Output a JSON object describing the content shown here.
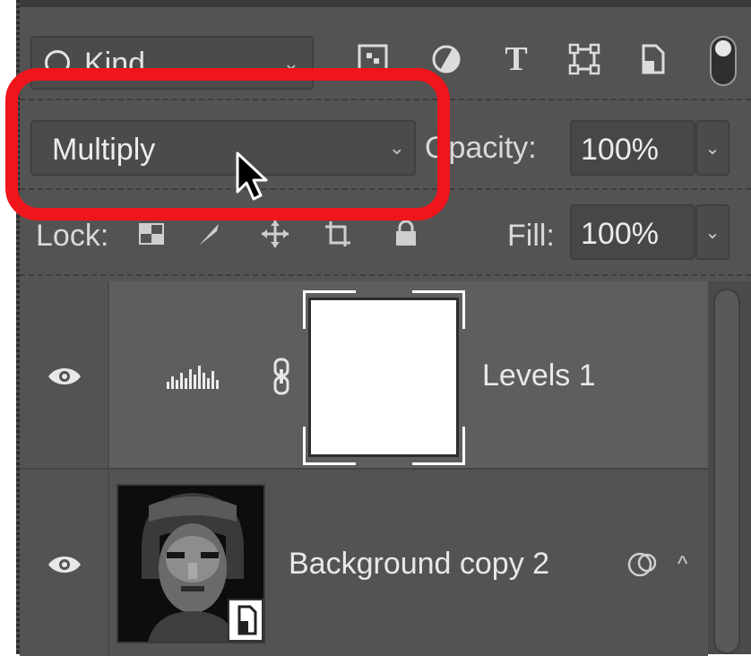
{
  "filter": {
    "kind_label": "Kind",
    "icons": [
      "pixel-filter-icon",
      "adjustment-filter-icon",
      "type-filter-icon",
      "shape-filter-icon",
      "smart-object-filter-icon"
    ]
  },
  "blend": {
    "mode": "Multiply",
    "opacity_label": "Opacity:",
    "opacity_value": "100%"
  },
  "lock": {
    "label": "Lock:",
    "fill_label": "Fill:",
    "fill_value": "100%",
    "icons": [
      "lock-transparent-icon",
      "lock-image-icon",
      "lock-position-icon",
      "lock-artboard-icon",
      "lock-all-icon"
    ]
  },
  "layers": [
    {
      "name": "Levels 1",
      "visible": true,
      "type": "adjustment",
      "selected": true
    },
    {
      "name": "Background copy 2",
      "visible": true,
      "type": "smart-object",
      "selected": false
    }
  ],
  "colors": {
    "panel": "#535353",
    "selected_row": "#5e5e5e",
    "highlight": "#f0141b",
    "text": "#e8e8e8"
  }
}
